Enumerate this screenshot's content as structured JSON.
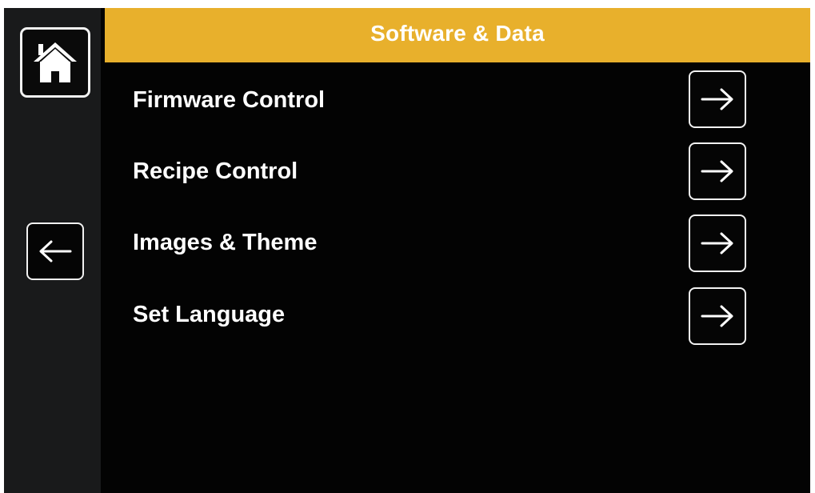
{
  "header": {
    "title": "Software & Data",
    "accent_color": "#e8b02c"
  },
  "sidebar": {
    "home_icon": "home-icon",
    "back_icon": "arrow-left-icon"
  },
  "menu": {
    "items": [
      {
        "label": "Firmware Control",
        "icon": "arrow-right-icon"
      },
      {
        "label": "Recipe Control",
        "icon": "arrow-right-icon"
      },
      {
        "label": "Images & Theme",
        "icon": "arrow-right-icon"
      },
      {
        "label": "Set Language",
        "icon": "arrow-right-icon"
      }
    ]
  }
}
